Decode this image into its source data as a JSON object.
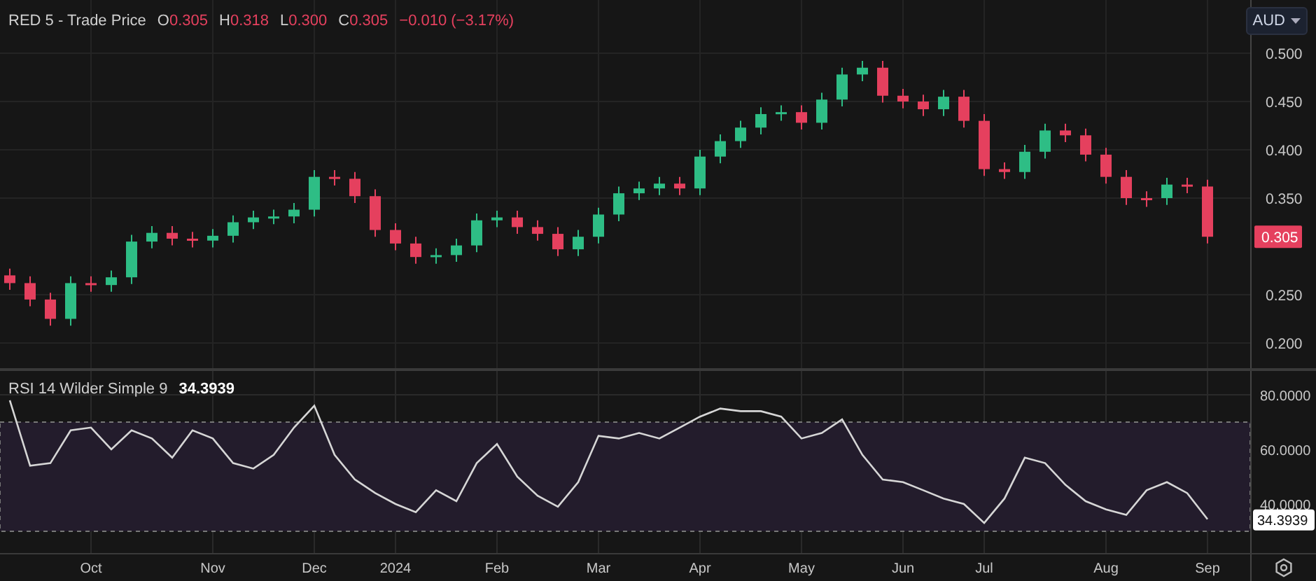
{
  "price_pane": {
    "legend": {
      "title": "RED 5 - Trade Price",
      "values": [
        {
          "key": "O",
          "value": "0.305"
        },
        {
          "key": "H",
          "value": "0.318"
        },
        {
          "key": "L",
          "value": "0.300"
        },
        {
          "key": "C",
          "value": "0.305"
        }
      ],
      "change": "−0.010 (−3.17%)"
    },
    "currency": "AUD",
    "last_price_tag": "0.305",
    "chart_data": {
      "type": "candlestick",
      "ylim": [
        0.1739,
        0.5551
      ],
      "grid": true,
      "yticks": [
        {
          "value": 0.5,
          "label": "0.500"
        },
        {
          "value": 0.45,
          "label": "0.450"
        },
        {
          "value": 0.4,
          "label": "0.400"
        },
        {
          "value": 0.35,
          "label": "0.350"
        },
        {
          "value": 0.25,
          "label": "0.250"
        },
        {
          "value": 0.2,
          "label": "0.200"
        }
      ],
      "ohlc": [
        [
          0.27,
          0.277,
          0.255,
          0.262
        ],
        [
          0.262,
          0.269,
          0.238,
          0.245
        ],
        [
          0.245,
          0.252,
          0.218,
          0.225
        ],
        [
          0.225,
          0.269,
          0.218,
          0.262
        ],
        [
          0.262,
          0.269,
          0.253,
          0.26
        ],
        [
          0.26,
          0.275,
          0.253,
          0.268
        ],
        [
          0.268,
          0.312,
          0.261,
          0.305
        ],
        [
          0.305,
          0.321,
          0.298,
          0.314
        ],
        [
          0.314,
          0.321,
          0.301,
          0.308
        ],
        [
          0.308,
          0.315,
          0.299,
          0.306
        ],
        [
          0.306,
          0.318,
          0.299,
          0.311
        ],
        [
          0.311,
          0.332,
          0.304,
          0.325
        ],
        [
          0.325,
          0.337,
          0.318,
          0.33
        ],
        [
          0.33,
          0.338,
          0.323,
          0.331
        ],
        [
          0.331,
          0.345,
          0.324,
          0.338
        ],
        [
          0.338,
          0.379,
          0.331,
          0.372
        ],
        [
          0.372,
          0.379,
          0.363,
          0.37
        ],
        [
          0.37,
          0.377,
          0.345,
          0.352
        ],
        [
          0.352,
          0.359,
          0.31,
          0.317
        ],
        [
          0.317,
          0.324,
          0.296,
          0.303
        ],
        [
          0.303,
          0.31,
          0.282,
          0.289
        ],
        [
          0.289,
          0.298,
          0.282,
          0.291
        ],
        [
          0.291,
          0.308,
          0.284,
          0.301
        ],
        [
          0.301,
          0.334,
          0.294,
          0.327
        ],
        [
          0.327,
          0.337,
          0.32,
          0.33
        ],
        [
          0.33,
          0.337,
          0.313,
          0.32
        ],
        [
          0.32,
          0.327,
          0.306,
          0.313
        ],
        [
          0.313,
          0.32,
          0.29,
          0.297
        ],
        [
          0.297,
          0.317,
          0.29,
          0.31
        ],
        [
          0.31,
          0.34,
          0.303,
          0.333
        ],
        [
          0.333,
          0.362,
          0.326,
          0.355
        ],
        [
          0.355,
          0.367,
          0.348,
          0.36
        ],
        [
          0.36,
          0.372,
          0.353,
          0.365
        ],
        [
          0.365,
          0.372,
          0.353,
          0.36
        ],
        [
          0.36,
          0.4,
          0.353,
          0.393
        ],
        [
          0.393,
          0.416,
          0.386,
          0.409
        ],
        [
          0.409,
          0.43,
          0.402,
          0.423
        ],
        [
          0.423,
          0.444,
          0.416,
          0.437
        ],
        [
          0.437,
          0.446,
          0.43,
          0.439
        ],
        [
          0.439,
          0.446,
          0.421,
          0.428
        ],
        [
          0.428,
          0.459,
          0.421,
          0.452
        ],
        [
          0.452,
          0.485,
          0.445,
          0.478
        ],
        [
          0.478,
          0.492,
          0.471,
          0.485
        ],
        [
          0.485,
          0.492,
          0.449,
          0.456
        ],
        [
          0.456,
          0.463,
          0.443,
          0.45
        ],
        [
          0.45,
          0.457,
          0.435,
          0.442
        ],
        [
          0.442,
          0.462,
          0.435,
          0.455
        ],
        [
          0.455,
          0.462,
          0.423,
          0.43
        ],
        [
          0.43,
          0.437,
          0.373,
          0.38
        ],
        [
          0.38,
          0.387,
          0.37,
          0.377
        ],
        [
          0.377,
          0.405,
          0.37,
          0.398
        ],
        [
          0.398,
          0.427,
          0.391,
          0.42
        ],
        [
          0.42,
          0.427,
          0.408,
          0.415
        ],
        [
          0.415,
          0.422,
          0.388,
          0.395
        ],
        [
          0.395,
          0.402,
          0.365,
          0.372
        ],
        [
          0.372,
          0.379,
          0.343,
          0.35
        ],
        [
          0.35,
          0.357,
          0.341,
          0.348
        ],
        [
          0.35,
          0.371,
          0.343,
          0.364
        ],
        [
          0.364,
          0.371,
          0.355,
          0.362
        ],
        [
          0.362,
          0.369,
          0.303,
          0.31
        ]
      ]
    }
  },
  "rsi_pane": {
    "value": "34.3939",
    "value_tag": "34.3939",
    "chart_data": {
      "type": "line",
      "ylim": [
        22.05,
        88.72
      ],
      "grid": true,
      "yticks": [
        {
          "value": 80,
          "label": "80.0000"
        },
        {
          "value": 60,
          "label": "60.0000"
        },
        {
          "value": 40,
          "label": "40.0000"
        }
      ],
      "categories": [
        null,
        null,
        null,
        null,
        "Oct",
        null,
        null,
        null,
        null,
        null,
        "Nov",
        null,
        null,
        null,
        null,
        "Dec",
        null,
        null,
        null,
        "2024",
        null,
        null,
        null,
        null,
        "Feb",
        null,
        null,
        null,
        null,
        "Mar",
        null,
        null,
        null,
        null,
        "Apr",
        null,
        null,
        null,
        null,
        "May",
        null,
        null,
        null,
        null,
        "Jun",
        null,
        null,
        null,
        "Jul",
        null,
        null,
        null,
        null,
        null,
        "Aug",
        null,
        null,
        null,
        null,
        "Sep"
      ],
      "series": [
        {
          "name": "RSI 14 Wilder Simple 9",
          "color": "#d6d6d6",
          "values": [
            78,
            54,
            55,
            67,
            68,
            60,
            67,
            64,
            57,
            67,
            64,
            55,
            53,
            58,
            68,
            76,
            58,
            49,
            44,
            40,
            37,
            45,
            41,
            55,
            62,
            50,
            43,
            39,
            48,
            65,
            64,
            66,
            64,
            68,
            72,
            75,
            74,
            74,
            72,
            64,
            66,
            71,
            58,
            49,
            48,
            45,
            42,
            40,
            33,
            42,
            57,
            55,
            47,
            41,
            38,
            36,
            45,
            48,
            44,
            34.4
          ]
        }
      ]
    }
  }
}
